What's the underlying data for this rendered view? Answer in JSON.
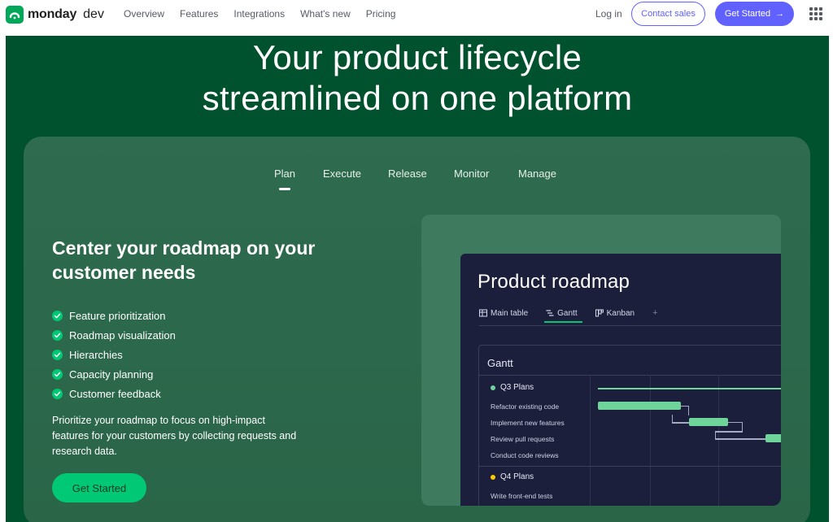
{
  "nav": {
    "brand_strong": "monday",
    "brand_light": "dev",
    "links": [
      "Overview",
      "Features",
      "Integrations",
      "What's new",
      "Pricing"
    ],
    "login": "Log in",
    "contact": "Contact sales",
    "get_started": "Get Started",
    "arrow": "→",
    "menu_icon": "grid-menu-icon"
  },
  "hero": {
    "title_line1": "Your product lifecycle",
    "title_line2": "streamlined on one platform"
  },
  "tabs": [
    "Plan",
    "Execute",
    "Release",
    "Monitor",
    "Manage"
  ],
  "active_tab": "Plan",
  "feature": {
    "heading": "Center your roadmap on your customer needs",
    "items": [
      "Feature prioritization",
      "Roadmap visualization",
      "Hierarchies",
      "Capacity planning",
      "Customer feedback"
    ],
    "description": "Prioritize your roadmap to focus on high-impact features for your customers by collecting requests and research data.",
    "cta": "Get Started"
  },
  "mock": {
    "title": "Product roadmap",
    "tabs": [
      {
        "label": "Main table",
        "icon": "table-icon"
      },
      {
        "label": "Gantt",
        "icon": "gantt-icon"
      },
      {
        "label": "Kanban",
        "icon": "kanban-icon"
      }
    ],
    "add_tab": "+",
    "gantt_title": "Gantt",
    "groups": [
      {
        "name": "Q3 Plans",
        "color": "#6fd49a",
        "tasks": [
          "Refactor existing code",
          "Implement new features",
          "Review pull requests",
          "Conduct code reviews"
        ]
      },
      {
        "name": "Q4 Plans",
        "color": "#ffcb00",
        "tasks": [
          "Write front-end tests"
        ]
      }
    ]
  },
  "colors": {
    "brand_green": "#00a859",
    "hero_bg": "#00512e",
    "panel_bg": "#2d6a4f",
    "accent_purple": "#6161ff",
    "cta_green": "#00c875",
    "mock_bg": "#1c1f3b"
  }
}
